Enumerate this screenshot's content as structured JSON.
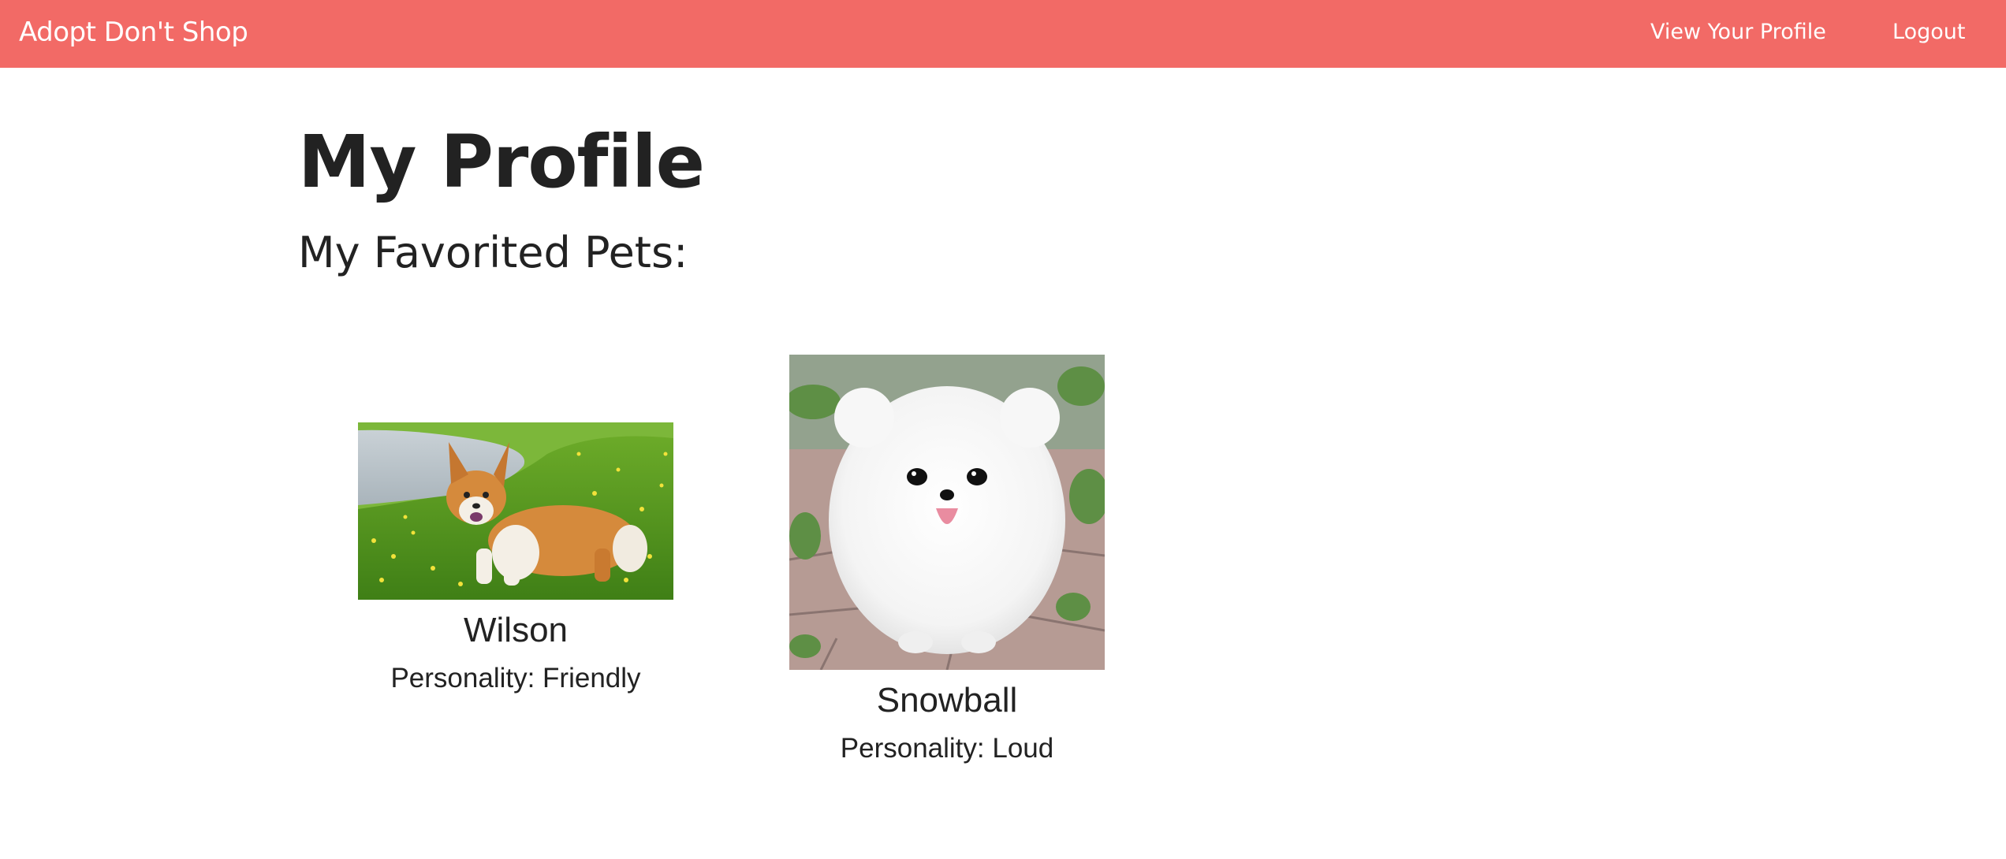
{
  "navbar": {
    "brand": "Adopt Don't Shop",
    "links": [
      {
        "label": "View Your Profile"
      },
      {
        "label": "Logout"
      }
    ],
    "color": "#f26a66"
  },
  "main": {
    "title": "My Profile",
    "favorites_heading": "My Favorited Pets:"
  },
  "pets": [
    {
      "name": "Wilson",
      "personality": "Personality: Friendly"
    },
    {
      "name": "Snowball",
      "personality": "Personality: Loud"
    }
  ]
}
